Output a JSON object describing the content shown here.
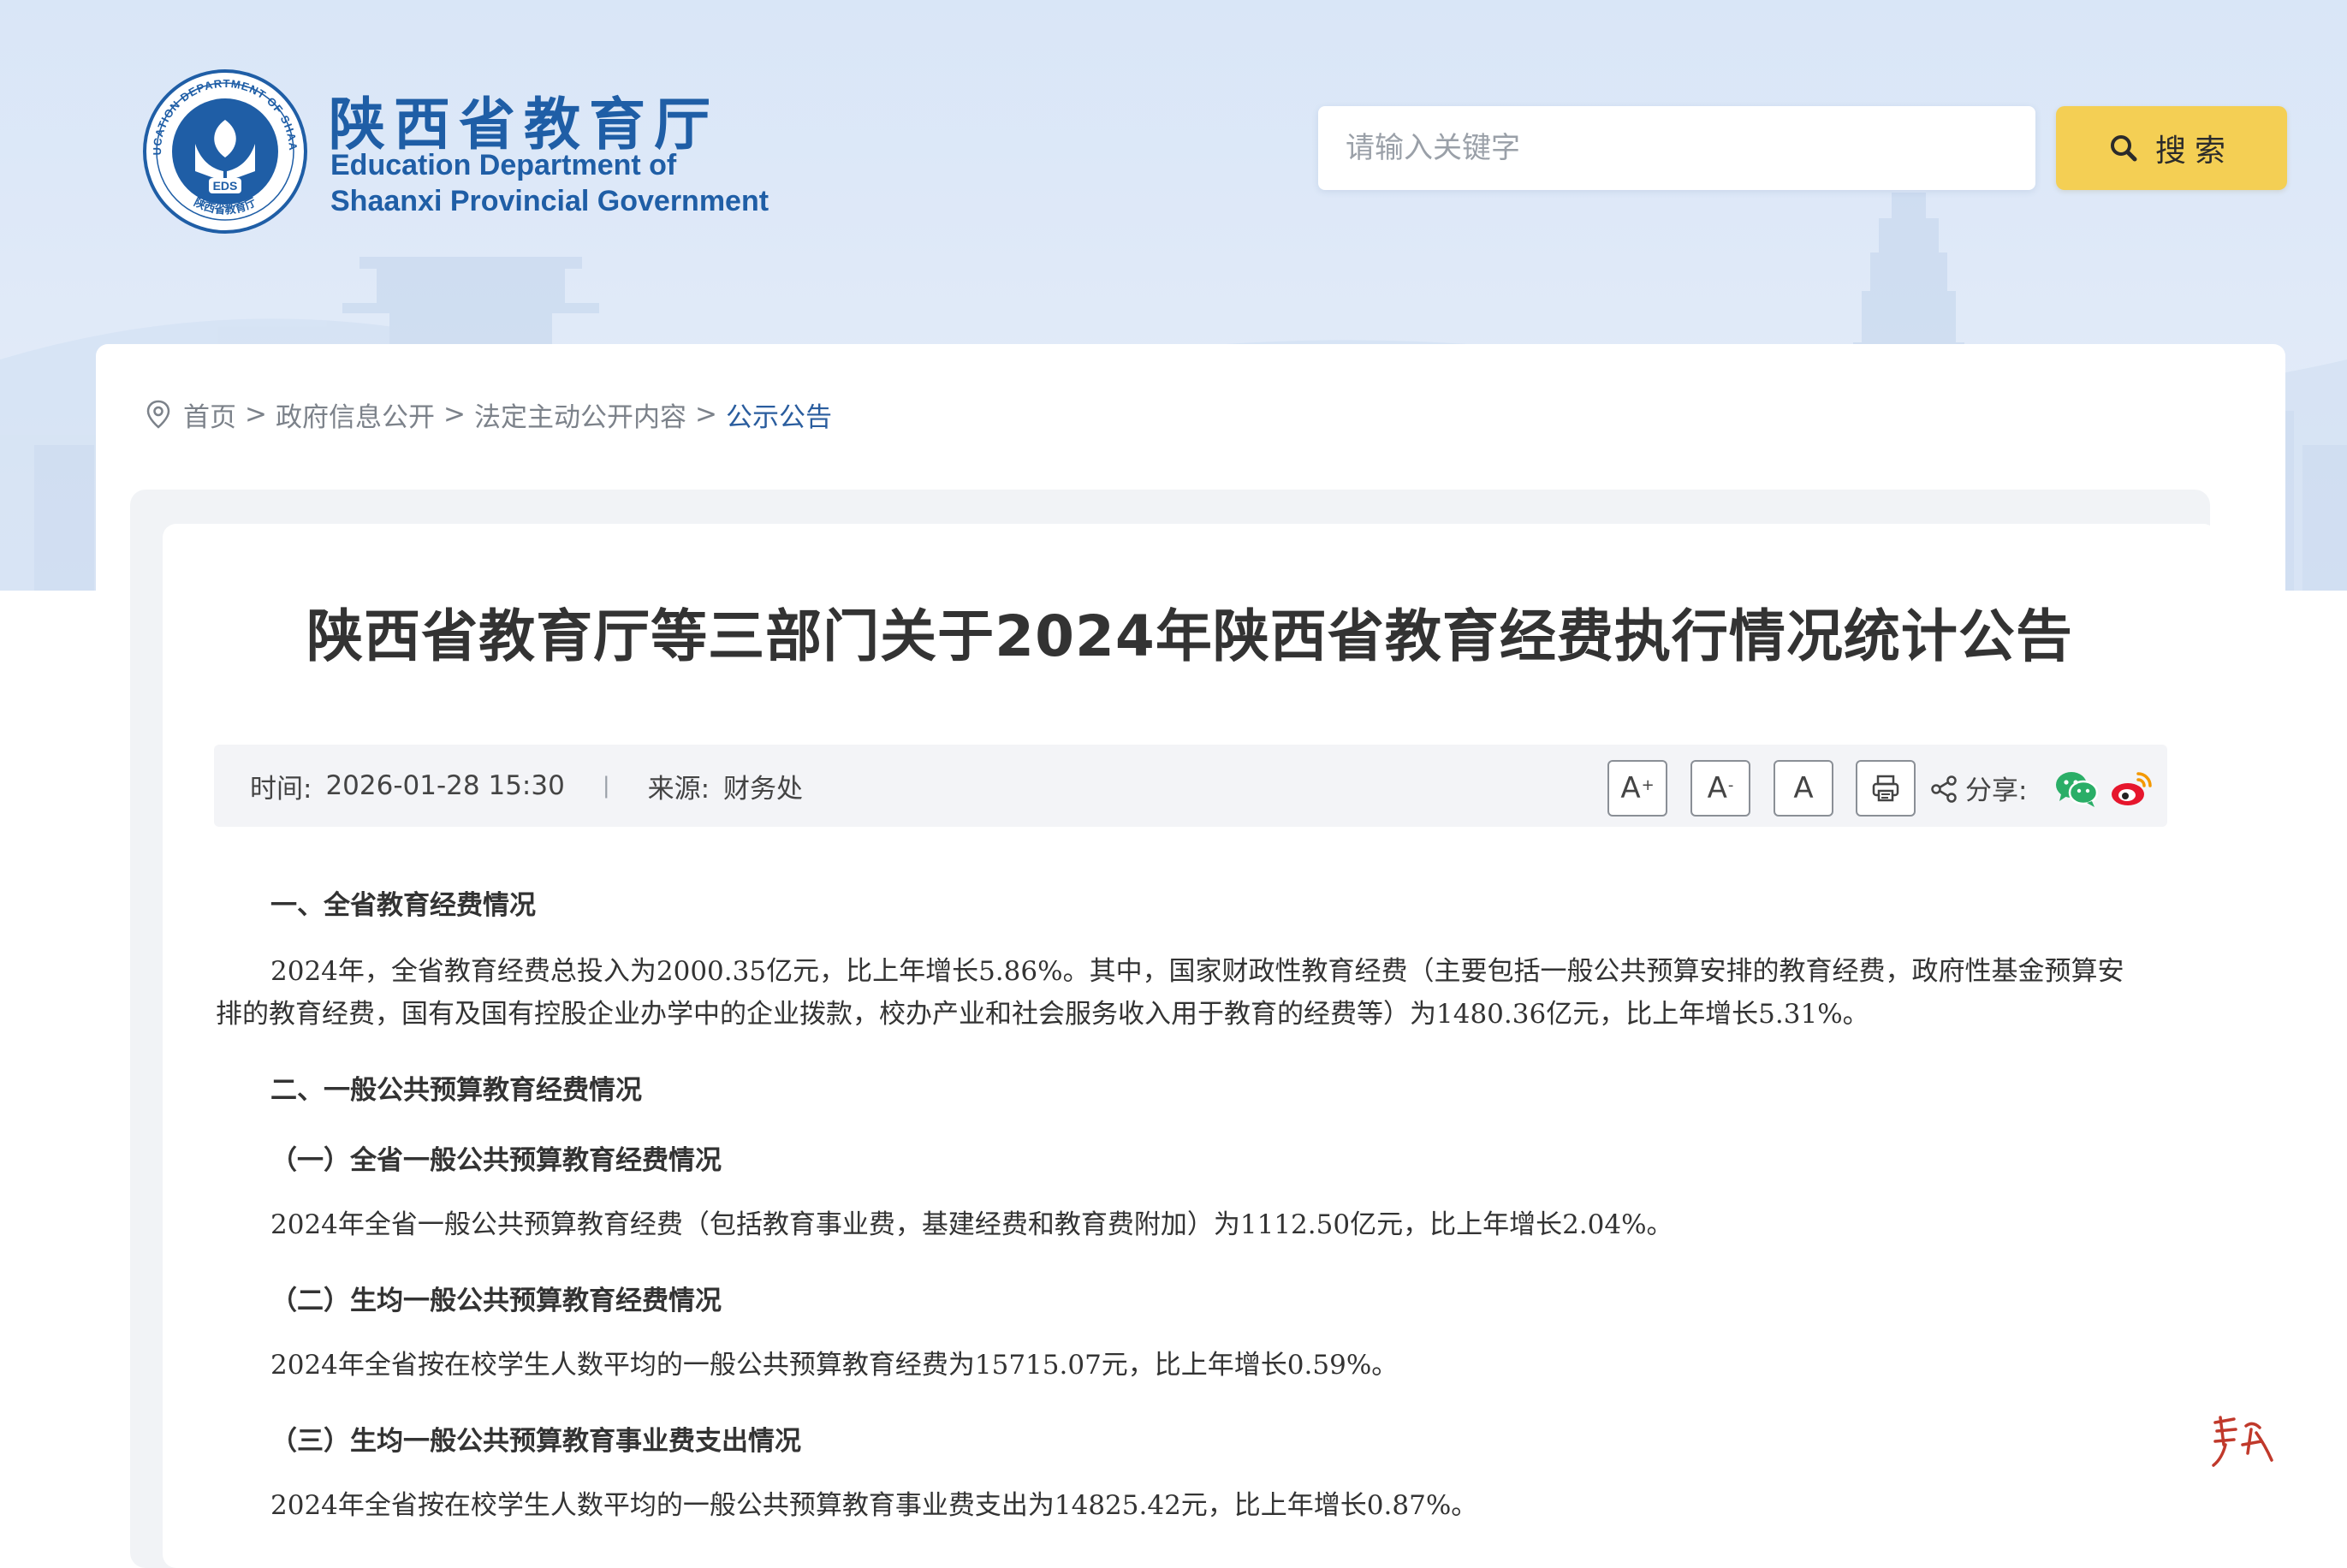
{
  "header": {
    "logo_emblem_text": "EDUCATION DEPARTMENT OF SHAANXI",
    "logo_emblem_center": "EDS",
    "logo_emblem_bottom": "陕西省教育厅",
    "site_name_cn": "陕西省教育厅",
    "site_name_en_line1": "Education Department of",
    "site_name_en_line2": "Shaanxi Provincial Government"
  },
  "search": {
    "placeholder": "请输入关键字",
    "button_label": "搜索"
  },
  "breadcrumb": {
    "items": [
      "首页",
      "政府信息公开",
      "法定主动公开内容"
    ],
    "current": "公示公告",
    "separator": ">"
  },
  "article": {
    "title": "陕西省教育厅等三部门关于2024年陕西省教育经费执行情况统计公告",
    "meta": {
      "time_label": "时间:",
      "time_value": "2026-01-28 15:30",
      "divider": "|",
      "source_label": "来源:",
      "source_value": "财务处"
    },
    "tools": {
      "font_increase": "A",
      "font_increase_sup": "+",
      "font_decrease": "A",
      "font_decrease_sup": "-",
      "font_reset": "A",
      "share_label": "分享:"
    },
    "sections": {
      "s1_heading": "一、全省教育经费情况",
      "s1_para_line1": "2024年，全省教育经费总投入为2000.35亿元，比上年增长5.86%。其中，国家财政性教育经费（主要包括一般公共预算安排的教育经费，政府性基金预算安",
      "s1_para_line2": "排的教育经费，国有及国有控股企业办学中的企业拨款，校办产业和社会服务收入用于教育的经费等）为1480.36亿元，比上年增长5.31%。",
      "s2_heading": "二、一般公共预算教育经费情况",
      "s2_1_heading": "（一）全省一般公共预算教育经费情况",
      "s2_1_para": "2024年全省一般公共预算教育经费（包括教育事业费，基建经费和教育费附加）为1112.50亿元，比上年增长2.04%。",
      "s2_2_heading": "（二）生均一般公共预算教育经费情况",
      "s2_2_para": "2024年全省按在校学生人数平均的一般公共预算教育经费为15715.07元，比上年增长0.59%。",
      "s2_3_heading": "（三）生均一般公共预算教育事业费支出情况",
      "s2_3_para": "2024年全省按在校学生人数平均的一般公共预算教育事业费支出为14825.42元，比上年增长0.87%。"
    }
  },
  "watermark_signature": "群众",
  "colors": {
    "brand_blue": "#1f5ea6",
    "search_button_yellow": "#f4cf54",
    "breadcrumb_current": "#2a5d9e",
    "wechat_green": "#2aae67",
    "weibo_red": "#e6162d"
  },
  "icons": {
    "search": "search-icon",
    "location": "location-pin-icon",
    "print": "print-icon",
    "share": "share-icon",
    "wechat": "wechat-icon",
    "weibo": "weibo-icon"
  }
}
